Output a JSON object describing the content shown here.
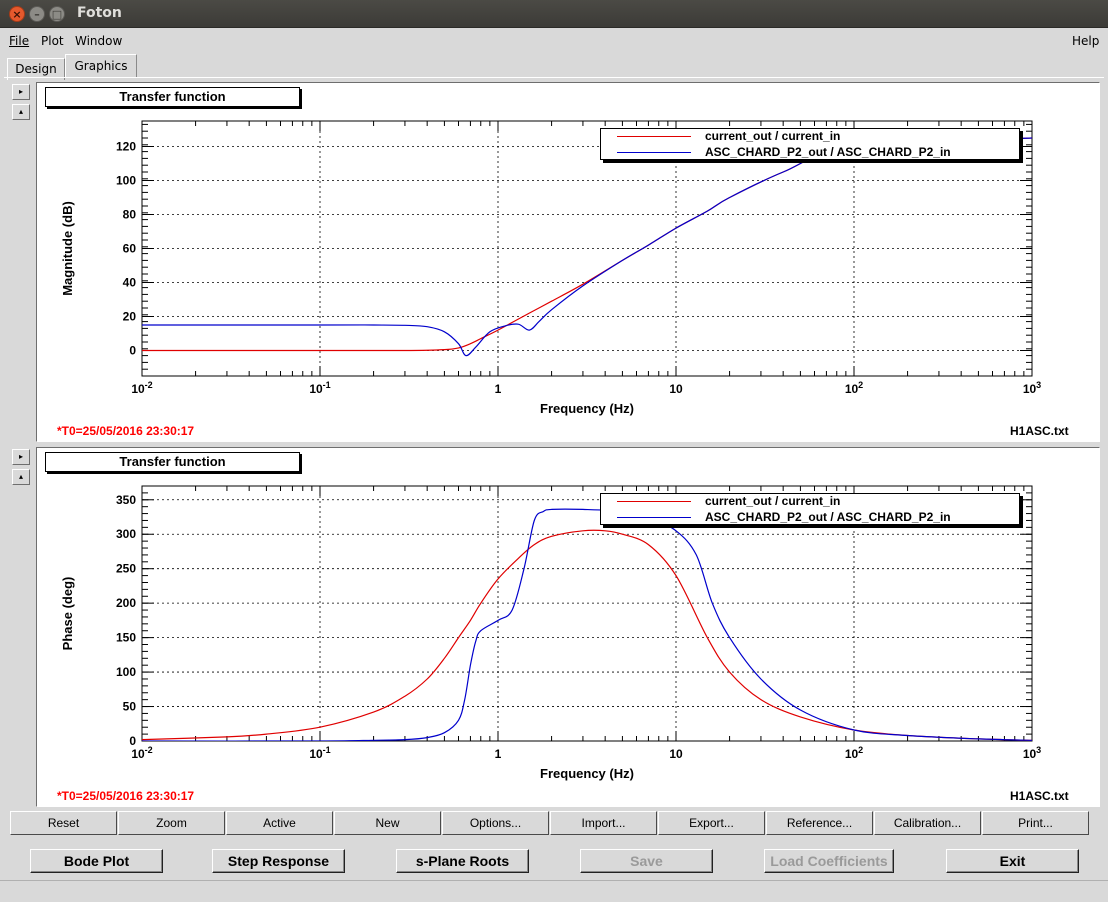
{
  "window": {
    "title": "Foton",
    "close_glyph": "×",
    "minimize_glyph": "–",
    "maximize_glyph": "□"
  },
  "menubar": {
    "file": "File",
    "plot": "Plot",
    "window": "Window",
    "help": "Help"
  },
  "tabs": [
    {
      "label": "Design"
    },
    {
      "label": "Graphics",
      "active": true
    }
  ],
  "side_buttons": {
    "expand_glyph": "▸",
    "collapse_glyph": "▴"
  },
  "colors": {
    "series_red": "#e00000",
    "series_blue": "#0000cc",
    "stamp_red": "#ff0000"
  },
  "plots": [
    {
      "pad_title": "Transfer function",
      "timestamp": "*T0=25/05/2016 23:30:17",
      "filename": "H1ASC.txt",
      "chart_data": {
        "type": "line",
        "xlabel": "Frequency (Hz)",
        "ylabel": "Magnitude (dB)",
        "xscale": "log",
        "xlim": [
          0.01,
          1000
        ],
        "ylim": [
          -15,
          135
        ],
        "yticks": [
          0,
          20,
          40,
          60,
          80,
          100,
          120
        ],
        "ytick_labels": [
          "0",
          "20",
          "40",
          "60",
          "80",
          "100",
          "120"
        ],
        "xtick_labels": [
          {
            "base": "10",
            "exp": "-2",
            "value": 0.01
          },
          {
            "base": "10",
            "exp": "-1",
            "value": 0.1
          },
          {
            "base": "1",
            "exp": "",
            "value": 1
          },
          {
            "base": "10",
            "exp": "",
            "value": 10
          },
          {
            "base": "10",
            "exp": "2",
            "value": 100
          },
          {
            "base": "10",
            "exp": "3",
            "value": 1000
          }
        ],
        "grid": true,
        "legend_position": "top-right",
        "series": [
          {
            "name": "current_out / current_in",
            "color": "#e00000",
            "x": [
              0.01,
              0.1,
              0.3,
              0.5,
              0.6,
              0.7,
              0.8,
              1,
              1.5,
              2,
              3,
              5,
              7,
              10,
              15,
              20,
              40,
              100,
              1000
            ],
            "y": [
              0,
              0,
              0,
              0.5,
              1.5,
              4,
              7,
              12,
              22,
              29,
              39,
              53,
              62,
              72,
              82,
              90,
              105,
              120,
              125
            ]
          },
          {
            "name": "ASC_CHARD_P2_out / ASC_CHARD_P2_in",
            "color": "#0000cc",
            "x": [
              0.01,
              0.1,
              0.2,
              0.3,
              0.4,
              0.5,
              0.6,
              0.66,
              0.75,
              0.9,
              1.1,
              1.3,
              1.5,
              1.7,
              2,
              3,
              5,
              7,
              10,
              15,
              20,
              40,
              100,
              1000
            ],
            "y": [
              15,
              15,
              15,
              14.8,
              14,
              11,
              4,
              -3,
              2,
              11,
              14.5,
              15.5,
              12,
              17,
              24,
              38,
              53,
              62,
              72,
              82,
              90,
              105,
              120,
              125
            ]
          }
        ]
      }
    },
    {
      "pad_title": "Transfer function",
      "timestamp": "*T0=25/05/2016 23:30:17",
      "filename": "H1ASC.txt",
      "chart_data": {
        "type": "line",
        "xlabel": "Frequency (Hz)",
        "ylabel": "Phase (deg)",
        "xscale": "log",
        "xlim": [
          0.01,
          1000
        ],
        "ylim": [
          0,
          370
        ],
        "yticks": [
          0,
          50,
          100,
          150,
          200,
          250,
          300,
          350
        ],
        "ytick_labels": [
          "0",
          "50",
          "100",
          "150",
          "200",
          "250",
          "300",
          "350"
        ],
        "xtick_labels": [
          {
            "base": "10",
            "exp": "-2",
            "value": 0.01
          },
          {
            "base": "10",
            "exp": "-1",
            "value": 0.1
          },
          {
            "base": "1",
            "exp": "",
            "value": 1
          },
          {
            "base": "10",
            "exp": "",
            "value": 10
          },
          {
            "base": "10",
            "exp": "2",
            "value": 100
          },
          {
            "base": "10",
            "exp": "3",
            "value": 1000
          }
        ],
        "grid": true,
        "legend_position": "top-right",
        "series": [
          {
            "name": "current_out / current_in",
            "color": "#e00000",
            "x": [
              0.01,
              0.03,
              0.05,
              0.1,
              0.2,
              0.3,
              0.4,
              0.5,
              0.6,
              0.7,
              0.8,
              1,
              1.3,
              1.6,
              2,
              3,
              4,
              5,
              7,
              10,
              15,
              20,
              30,
              50,
              100,
              200,
              500,
              1000
            ],
            "y": [
              2,
              6,
              10,
              20,
              42,
              65,
              90,
              120,
              150,
              175,
              200,
              235,
              265,
              285,
              297,
              305,
              305,
              300,
              285,
              240,
              150,
              100,
              60,
              35,
              16,
              8,
              3,
              1
            ],
            "note": ""
          },
          {
            "name": "ASC_CHARD_P2_out / ASC_CHARD_P2_in",
            "color": "#0000cc",
            "x": [
              0.01,
              0.1,
              0.2,
              0.3,
              0.4,
              0.5,
              0.6,
              0.65,
              0.7,
              0.75,
              0.8,
              1,
              1.2,
              1.4,
              1.6,
              1.8,
              2,
              3,
              5,
              7,
              10,
              13,
              16,
              20,
              30,
              50,
              100,
              200,
              500,
              1000
            ],
            "y": [
              0,
              0,
              1,
              2,
              5,
              12,
              30,
              60,
              110,
              145,
              160,
              175,
              190,
              250,
              320,
              333,
              336,
              336,
              333,
              325,
              305,
              270,
              200,
              150,
              90,
              45,
              16,
              8,
              3,
              1
            ]
          }
        ]
      }
    }
  ],
  "plot_buttons": [
    "Reset",
    "Zoom",
    "Active",
    "New",
    "Options...",
    "Import...",
    "Export...",
    "Reference...",
    "Calibration...",
    "Print..."
  ],
  "bottom_buttons": [
    {
      "label": "Bode Plot",
      "enabled": true
    },
    {
      "label": "Step Response",
      "enabled": true
    },
    {
      "label": "s-Plane Roots",
      "enabled": true
    },
    {
      "label": "Save",
      "enabled": false
    },
    {
      "label": "Load Coefficients",
      "enabled": false
    },
    {
      "label": "Exit",
      "enabled": true
    }
  ]
}
